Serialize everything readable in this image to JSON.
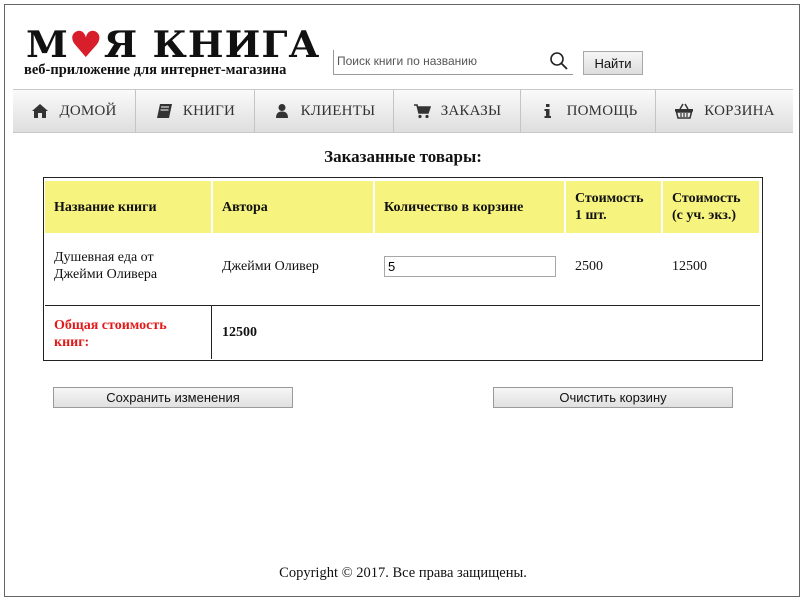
{
  "header": {
    "logo_title_part1": "М",
    "logo_title_part2": "Я КНИГА",
    "logo_subtitle": "веб-приложение для интернет-магазина",
    "search_placeholder": "Поиск книги по названию",
    "search_value": "",
    "find_button": "Найти"
  },
  "nav": {
    "items": [
      {
        "label": "ДОМОЙ",
        "icon": "home-icon"
      },
      {
        "label": "КНИГИ",
        "icon": "book-icon"
      },
      {
        "label": "КЛИЕНТЫ",
        "icon": "user-icon"
      },
      {
        "label": "ЗАКАЗЫ",
        "icon": "cart-icon"
      },
      {
        "label": "ПОМОЩЬ",
        "icon": "info-icon"
      },
      {
        "label": "КОРЗИНА",
        "icon": "basket-icon"
      }
    ]
  },
  "main": {
    "heading": "Заказанные товары:",
    "table": {
      "headers": [
        "Название книги",
        "Автора",
        "Количество в корзине",
        "Стоимость 1 шт.",
        "Стоимость (с уч. экз.)"
      ],
      "rows": [
        {
          "title": "Душевная еда от Джейми Оливера",
          "author": "Джейми Оливер",
          "quantity": "5",
          "unit_price": "2500",
          "total_price": "12500"
        }
      ],
      "total_label": "Общая стоимость книг:",
      "total_value": "12500"
    },
    "save_button": "Сохранить изменения",
    "clear_button": "Очистить корзину"
  },
  "footer": {
    "copyright": "Copyright © 2017. Все права защищены."
  },
  "colors": {
    "header_cell_bg": "#f6f37f",
    "total_label": "#e21a1a",
    "logo_heart": "#d81e2a"
  }
}
